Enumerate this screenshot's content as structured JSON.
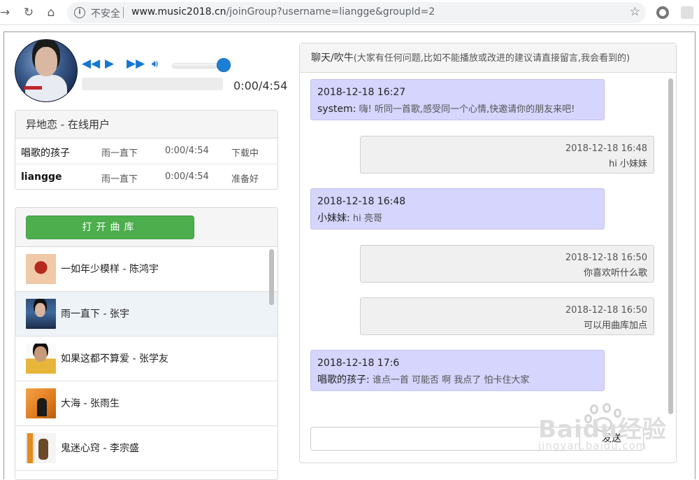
{
  "browser": {
    "insecure_label": "不安全",
    "url_host": "www.music2018.cn",
    "url_path": "/joinGroup?username=liangge&groupId=2"
  },
  "player": {
    "time": "0:00/4:54",
    "volume_level": 0.9,
    "progress": 0
  },
  "users_panel": {
    "title": "异地恋 - 在线用户",
    "users": [
      {
        "name": "唱歌的孩子",
        "song": "雨一直下",
        "time": "0:00/4:54",
        "state": "下载中"
      },
      {
        "name": "liangge",
        "song": "雨一直下",
        "time": "0:00/4:54",
        "state": "准备好"
      }
    ]
  },
  "library": {
    "open_button": "打开曲库",
    "songs": [
      {
        "title": "一如年少模样 - 陈鸿宇"
      },
      {
        "title": "雨一直下 - 张宇"
      },
      {
        "title": "如果这都不算爱 - 张学友"
      },
      {
        "title": "大海 - 张雨生"
      },
      {
        "title": "鬼迷心窍 - 李宗盛"
      }
    ]
  },
  "chat": {
    "title": "聊天/吹牛",
    "subtitle": "(大家有任何问题,比如不能播放或改进的建议请直接留言,我会看到的)",
    "messages": [
      {
        "side": "left",
        "time": "2018-12-18 16:27",
        "sender": "system:",
        "text": "嗨! 听同一首歌,感受同一个心情,快邀请你的朋友来吧!"
      },
      {
        "side": "right",
        "time": "2018-12-18 16:48",
        "text": "hi 小妹妹"
      },
      {
        "side": "left",
        "time": "2018-12-18 16:48",
        "sender": "小妹妹:",
        "text": "hi 亮哥"
      },
      {
        "side": "right",
        "time": "2018-12-18 16:50",
        "text": "你喜欢听什么歌"
      },
      {
        "side": "right",
        "time": "2018-12-18 16:50",
        "text": "可以用曲库加点"
      },
      {
        "side": "left",
        "time": "2018-12-18 17:6",
        "sender": "唱歌的孩子:",
        "text": "谁点一首 可能否 啊 我点了 怕卡住大家"
      }
    ],
    "send_button": "发送"
  },
  "watermark": {
    "brand": "Baidu经验",
    "sub": "jingyan.baidu.com"
  },
  "colors": {
    "accent_blue": "#1577d4",
    "button_green": "#4cae4c",
    "bubble_left": "#d5d5fd",
    "bubble_right": "#f0f0f0"
  }
}
